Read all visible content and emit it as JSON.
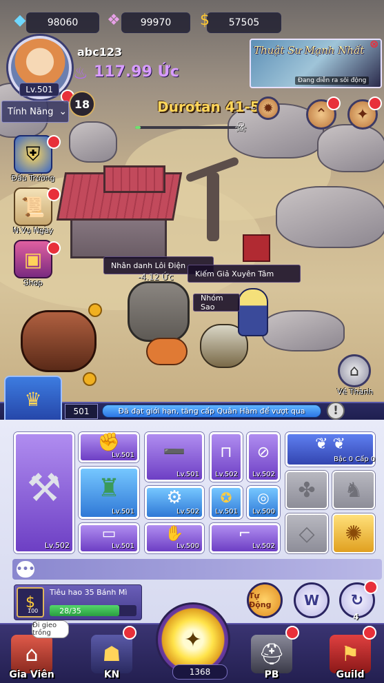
{
  "resources": {
    "diamonds": "98060",
    "gems": "99970",
    "gold": "57505"
  },
  "player": {
    "name": "abc123",
    "level": "Lv.501",
    "power": "117.99 Ức",
    "age_badge": "18"
  },
  "features_label": "Tính Năng",
  "side_menu": [
    {
      "label": "Đấu Trường",
      "icon": "shield-icon"
    },
    {
      "label": "N.Vụ Ngày",
      "icon": "scroll-icon"
    },
    {
      "label": "Shop",
      "icon": "chest-icon"
    }
  ],
  "stage": {
    "title": "Durotan 41-5",
    "progress": 0.05
  },
  "event": {
    "title": "Thuật Sư Mạnh Nhất",
    "subtitle": "Đang diễn ra sôi động"
  },
  "battle": {
    "nameplates": [
      "Nhân danh Lôi Điện",
      "Kiếm Giả Xuyên Tâm",
      "Nhóm Sao"
    ],
    "damage": "-4.12 Ức"
  },
  "return_city_label": "Về Thành",
  "notice": {
    "level": "501",
    "text": "Đã đạt giới hạn, tăng cấp Quân Hàm để vượt qua"
  },
  "equipment": {
    "main_weapon": {
      "level": "Lv.502",
      "icon": "axe-icon"
    },
    "slots": [
      {
        "level": "Lv.501",
        "icon": "gauntlet-icon",
        "tone": "purple"
      },
      {
        "level": "Lv.501",
        "icon": "headband-icon",
        "tone": "purple"
      },
      {
        "level": "Lv.502",
        "icon": "pants-icon",
        "tone": "purple"
      },
      {
        "level": "Lv.502",
        "icon": "necklace-icon",
        "tone": "purple"
      },
      {
        "level": "Lv.501",
        "icon": "robe-icon",
        "tone": "blue"
      },
      {
        "level": "Lv.502",
        "icon": "bracer-icon",
        "tone": "blue"
      },
      {
        "level": "Lv.501",
        "icon": "amulet-icon",
        "tone": "blue"
      },
      {
        "level": "Lv.500",
        "icon": "ring-icon",
        "tone": "blue"
      },
      {
        "level": "Lv.501",
        "icon": "belt-icon",
        "tone": "purple"
      },
      {
        "level": "Lv.500",
        "icon": "glove-icon",
        "tone": "purple"
      },
      {
        "level": "Lv.502",
        "icon": "boots-icon",
        "tone": "purple"
      }
    ],
    "wings_label": "Bậc 0 Cấp 0"
  },
  "quest": {
    "title": "Tiêu hao 35 Bánh Mì",
    "progress_text": "28/35",
    "progress": 0.8,
    "icon_value": "100"
  },
  "actions": {
    "auto_label": "Tự Động",
    "w_label": "W",
    "refresh_count": "4"
  },
  "bottom_nav": {
    "items": [
      "Gia Viên",
      "KN",
      "PB",
      "Guild"
    ],
    "tooltip": "Đi gieo trồng",
    "coin_count": "1368"
  }
}
